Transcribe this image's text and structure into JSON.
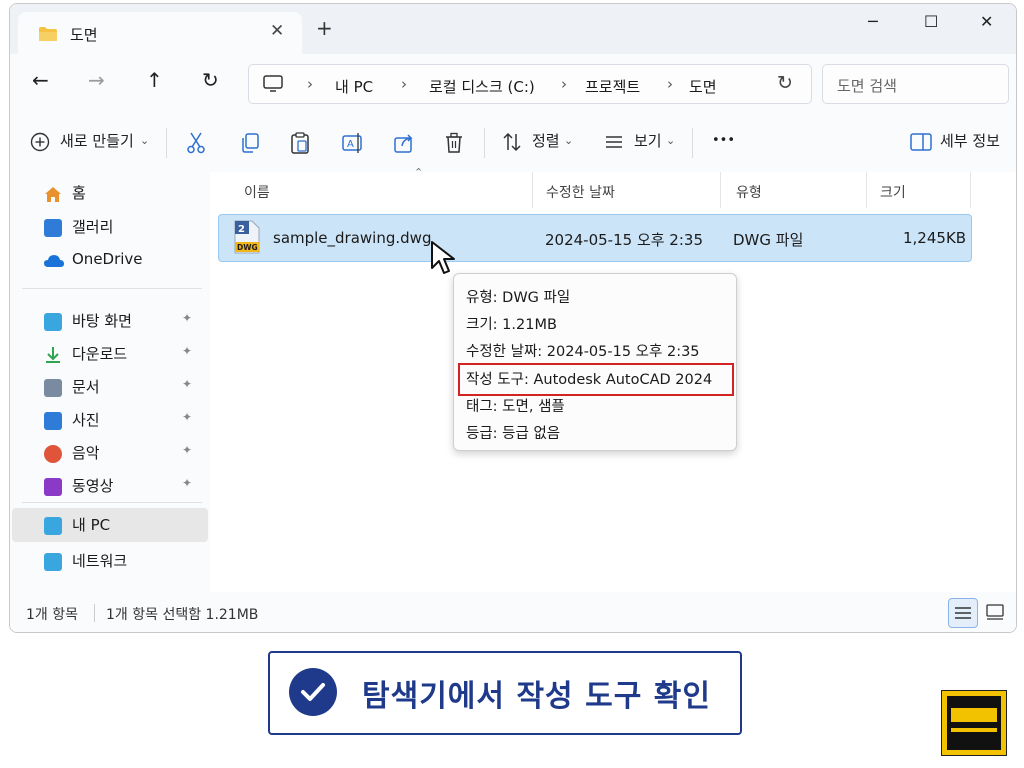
{
  "tab": {
    "title": "도면",
    "close": "✕",
    "new": "+"
  },
  "window_controls": {
    "minimize": "─",
    "maximize": "☐",
    "close": "✕"
  },
  "nav": {
    "back": "←",
    "forward": "→",
    "up": "↑",
    "refresh": "↻"
  },
  "breadcrumb": [
    "내 PC",
    "로컬 디스크 (C:)",
    "프로젝트",
    "도면"
  ],
  "breadcrumb_sep": "›",
  "search": {
    "placeholder": "도면 검색"
  },
  "toolbar": {
    "new_label": "새로 만들기",
    "sort_label": "정렬",
    "view_label": "보기",
    "more_label": "•••",
    "details_label": "세부 정보"
  },
  "sidebar": {
    "items": [
      {
        "label": "홈",
        "icon": "home-icon",
        "color": "#e8912d"
      },
      {
        "label": "갤러리",
        "icon": "gallery-icon",
        "color": "#2f7bd8"
      },
      {
        "label": "OneDrive",
        "icon": "onedrive-icon",
        "color": "#1a73d8"
      },
      {
        "label": "바탕 화면",
        "icon": "desktop-icon",
        "color": "#3aa6e0"
      },
      {
        "label": "다운로드",
        "icon": "download-icon",
        "color": "#2fa34f"
      },
      {
        "label": "문서",
        "icon": "document-icon",
        "color": "#7a8aa0"
      },
      {
        "label": "사진",
        "icon": "pictures-icon",
        "color": "#2f7bd8"
      },
      {
        "label": "음악",
        "icon": "music-icon",
        "color": "#e0553a"
      },
      {
        "label": "동영상",
        "icon": "video-icon",
        "color": "#8a3ac7"
      },
      {
        "label": "내 PC",
        "icon": "pc-icon",
        "color": "#3aa6e0"
      },
      {
        "label": "네트워크",
        "icon": "network-icon",
        "color": "#3aa6e0"
      }
    ],
    "pin": "📌"
  },
  "columns": {
    "name": "이름",
    "modified": "수정한 날짜",
    "type": "유형",
    "size": "크기"
  },
  "file": {
    "name": "sample_drawing.dwg",
    "modified": "2024-05-15 오후 2:35",
    "type": "DWG 파일",
    "size": "1,245KB",
    "icon_badge": "DWG",
    "icon_top": "2"
  },
  "tooltip": {
    "type": "유형: DWG 파일",
    "size": "크기: 1.21MB",
    "modified": "수정한 날짜: 2024-05-15 오후 2:35",
    "author_tool": "작성 도구: Autodesk AutoCAD 2024",
    "tags": "태그: 도면, 샘플",
    "rating": "등급: 등급 없음"
  },
  "status": {
    "count": "1개 항목",
    "selected": "1개 항목 선택함 1.21MB"
  },
  "banner": {
    "text": "탐색기에서 작성 도구 확인"
  },
  "colors": {
    "accent": "#1f3a8a",
    "selection": "#cce4f7",
    "highlight": "#d32222"
  }
}
